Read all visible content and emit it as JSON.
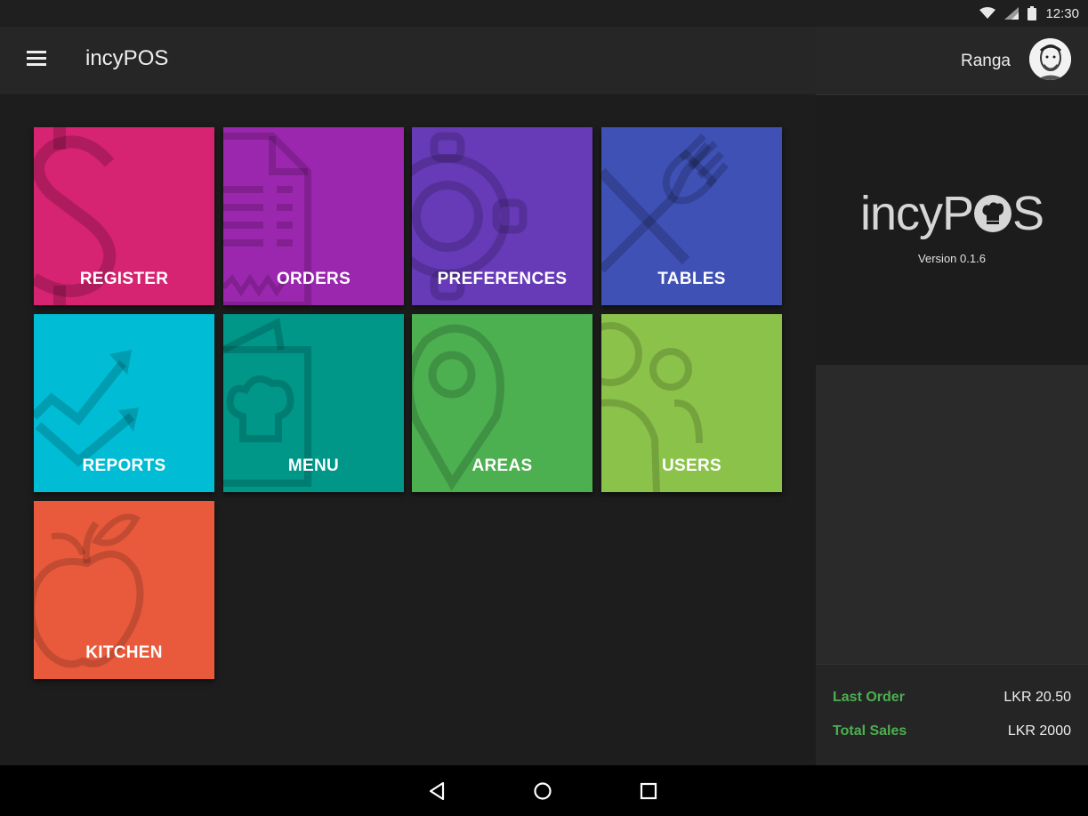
{
  "status_bar": {
    "time": "12:30",
    "icons": [
      "wifi-icon",
      "signal-icon",
      "battery-icon"
    ]
  },
  "app_bar": {
    "title": "incyPOS",
    "menu_icon": "hamburger-menu-icon"
  },
  "tiles": [
    {
      "label": "REGISTER",
      "color": "#d62372",
      "icon": "dollar-icon"
    },
    {
      "label": "ORDERS",
      "color": "#9b27af",
      "icon": "receipt-icon"
    },
    {
      "label": "PREFERENCES",
      "color": "#673ab7",
      "icon": "gear-icon"
    },
    {
      "label": "TABLES",
      "color": "#3f51b5",
      "icon": "fork-knife-icon"
    },
    {
      "label": "REPORTS",
      "color": "#00bcd4",
      "icon": "trend-chart-icon"
    },
    {
      "label": "MENU",
      "color": "#009688",
      "icon": "menu-book-icon"
    },
    {
      "label": "AREAS",
      "color": "#4caf50",
      "icon": "map-pin-icon"
    },
    {
      "label": "USERS",
      "color": "#8bc34a",
      "icon": "users-icon"
    },
    {
      "label": "KITCHEN",
      "color": "#e95a3c",
      "icon": "apple-icon"
    }
  ],
  "sidebar": {
    "user_name": "Ranga",
    "logo_text_left": "incyP",
    "logo_text_right": "S",
    "version": "Version 0.1.6",
    "stats": [
      {
        "label": "Last Order",
        "value": "LKR 20.50"
      },
      {
        "label": "Total Sales",
        "value": "LKR 2000"
      }
    ]
  },
  "nav_bar": {
    "icons": [
      "back-icon",
      "home-icon",
      "recents-icon"
    ]
  },
  "colors": {
    "accent_green": "#4caf50",
    "background": "#1d1d1d",
    "sidebar": "#2a2a2a"
  }
}
